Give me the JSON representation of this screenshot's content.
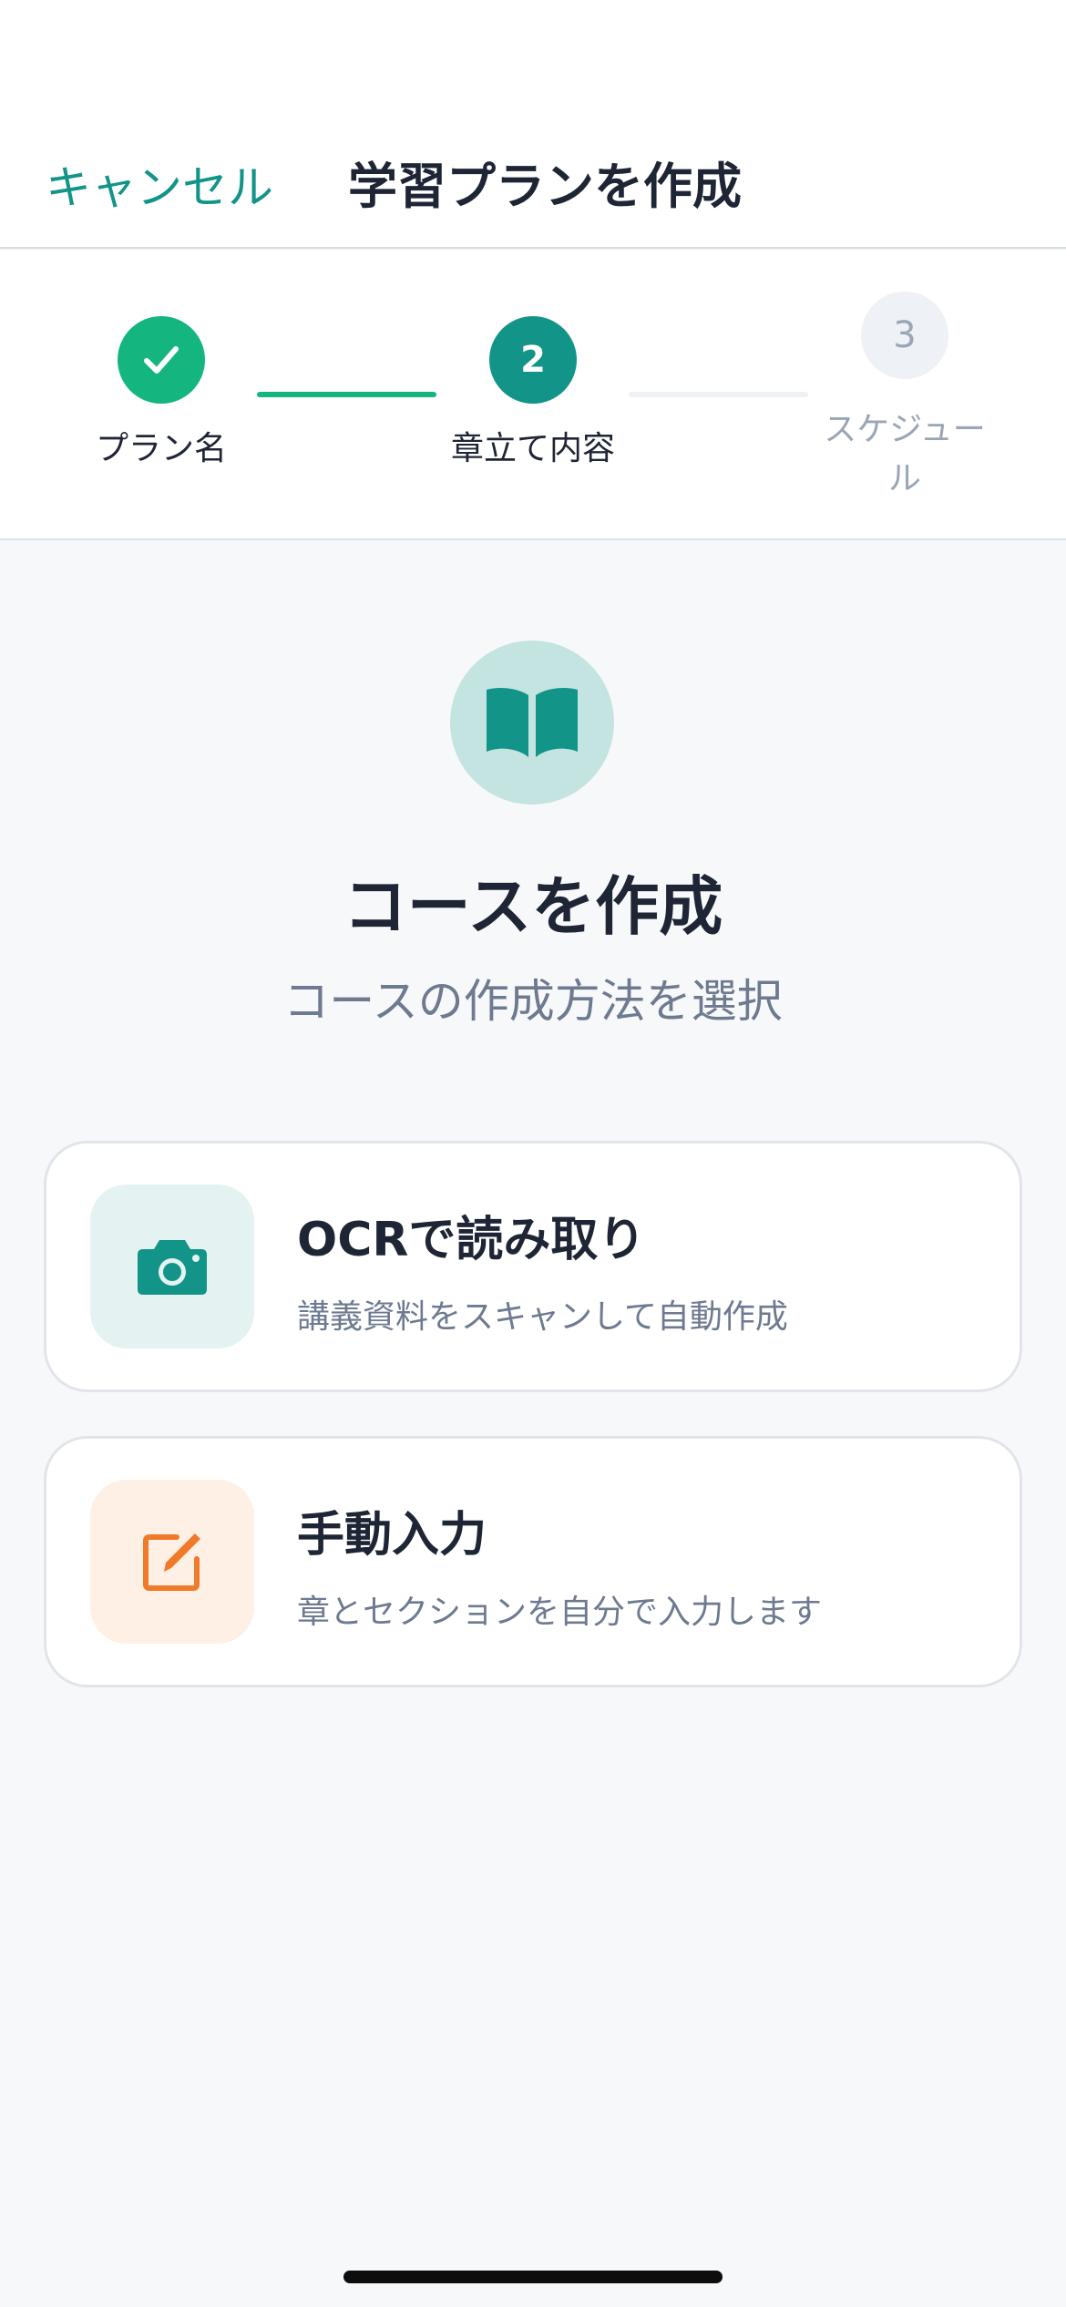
{
  "header": {
    "cancel_label": "キャンセル",
    "title": "学習プランを作成"
  },
  "stepper": {
    "steps": [
      {
        "label": "プラン名",
        "state": "completed",
        "icon": "check-icon"
      },
      {
        "label": "章立て内容",
        "number": "2",
        "state": "current"
      },
      {
        "label_line1": "スケジュー",
        "label_line2": "ル",
        "number": "3",
        "state": "upcoming"
      }
    ]
  },
  "hero": {
    "icon": "book-open-icon",
    "title": "コースを作成",
    "subtitle": "コースの作成方法を選択"
  },
  "options": [
    {
      "icon": "camera-icon",
      "title": "OCRで読み取り",
      "description": "講義資料をスキャンして自動作成"
    },
    {
      "icon": "edit-icon",
      "title": "手動入力",
      "description": "章とセクションを自分で入力します"
    }
  ],
  "colors": {
    "accent": "#139488",
    "success": "#14b57e",
    "text_primary": "#1e2535",
    "text_secondary": "#6d7a90",
    "muted": "#9aa6b6",
    "manual_accent": "#f07a2a"
  }
}
